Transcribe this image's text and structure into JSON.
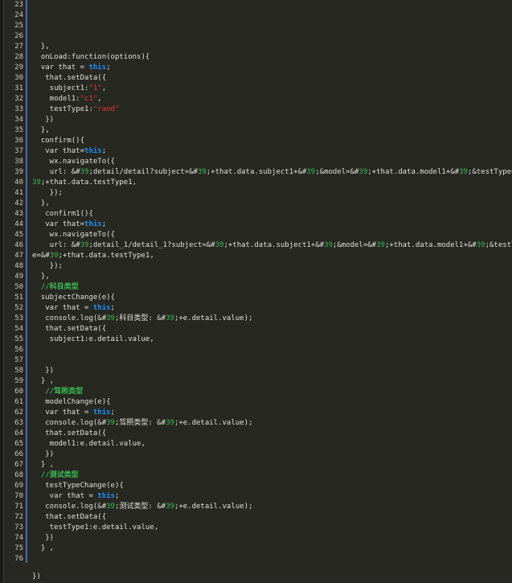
{
  "editor": {
    "closing": "})",
    "lines": [
      {
        "n": "23",
        "segs": []
      },
      {
        "n": "24",
        "segs": []
      },
      {
        "n": "25",
        "segs": []
      },
      {
        "n": "26",
        "segs": []
      },
      {
        "n": "27",
        "segs": [
          {
            "t": "  },",
            "c": ""
          }
        ]
      },
      {
        "n": "28",
        "segs": [
          {
            "t": "  onLoad:function(options){",
            "c": ""
          }
        ]
      },
      {
        "n": "29",
        "segs": [
          {
            "t": "  var that = ",
            "c": ""
          },
          {
            "t": "this",
            "c": "kw"
          },
          {
            "t": ";",
            "c": ""
          }
        ]
      },
      {
        "n": "30",
        "segs": [
          {
            "t": "   that.setData({",
            "c": ""
          }
        ]
      },
      {
        "n": "31",
        "segs": [
          {
            "t": "    subject1:",
            "c": ""
          },
          {
            "t": "\"1\"",
            "c": "str"
          },
          {
            "t": ",",
            "c": ""
          }
        ]
      },
      {
        "n": "32",
        "segs": [
          {
            "t": "    model1:",
            "c": ""
          },
          {
            "t": "\"c1\"",
            "c": "str"
          },
          {
            "t": ",",
            "c": ""
          }
        ]
      },
      {
        "n": "33",
        "segs": [
          {
            "t": "    testType1:",
            "c": ""
          },
          {
            "t": "\"rand\"",
            "c": "str"
          }
        ]
      },
      {
        "n": "34",
        "segs": [
          {
            "t": "   })",
            "c": ""
          }
        ]
      },
      {
        "n": "35",
        "segs": [
          {
            "t": "  },",
            "c": ""
          }
        ]
      },
      {
        "n": "36",
        "segs": [
          {
            "t": "  confirm(){",
            "c": ""
          }
        ]
      },
      {
        "n": "37",
        "segs": [
          {
            "t": "   var that=",
            "c": ""
          },
          {
            "t": "this",
            "c": "kw"
          },
          {
            "t": ";",
            "c": ""
          }
        ]
      },
      {
        "n": "38",
        "segs": [
          {
            "t": "    wx.navigateTo({",
            "c": ""
          }
        ]
      },
      {
        "n": "39",
        "segs": [
          {
            "t": "    url: &#",
            "c": ""
          },
          {
            "t": "39",
            "c": "ent"
          },
          {
            "t": ";detail/detail?subject=&#",
            "c": ""
          },
          {
            "t": "39",
            "c": "ent"
          },
          {
            "t": ";+that.data.subject1+&#",
            "c": ""
          },
          {
            "t": "39",
            "c": "ent"
          },
          {
            "t": ";&model=&#",
            "c": ""
          },
          {
            "t": "39",
            "c": "ent"
          },
          {
            "t": ";+that.data.model1+&#",
            "c": ""
          },
          {
            "t": "39",
            "c": "ent"
          },
          {
            "t": ";&testType=&#",
            "c": ""
          }
        ]
      },
      {
        "n": "40",
        "segs": [
          {
            "t": "39",
            "c": "ent"
          },
          {
            "t": ";+that.data.testType1,",
            "c": ""
          }
        ]
      },
      {
        "n": "41",
        "segs": [
          {
            "t": "    });",
            "c": ""
          }
        ]
      },
      {
        "n": "42",
        "segs": [
          {
            "t": "  },",
            "c": ""
          }
        ]
      },
      {
        "n": "43",
        "segs": [
          {
            "t": "   confirm1(){",
            "c": ""
          }
        ]
      },
      {
        "n": "44",
        "segs": [
          {
            "t": "   var that=",
            "c": ""
          },
          {
            "t": "this",
            "c": "kw"
          },
          {
            "t": ";",
            "c": ""
          }
        ]
      },
      {
        "n": "45",
        "segs": [
          {
            "t": "    wx.navigateTo({",
            "c": ""
          }
        ]
      },
      {
        "n": "46",
        "segs": [
          {
            "t": "    url: &#",
            "c": ""
          },
          {
            "t": "39",
            "c": "ent"
          },
          {
            "t": ";detail_1/detail_1?subject=&#",
            "c": ""
          },
          {
            "t": "39",
            "c": "ent"
          },
          {
            "t": ";+that.data.subject1+&#",
            "c": ""
          },
          {
            "t": "39",
            "c": "ent"
          },
          {
            "t": ";&model=&#",
            "c": ""
          },
          {
            "t": "39",
            "c": "ent"
          },
          {
            "t": ";+that.data.model1+&#",
            "c": ""
          },
          {
            "t": "39",
            "c": "ent"
          },
          {
            "t": ";&testTyp",
            "c": ""
          }
        ]
      },
      {
        "n": "47",
        "segs": [
          {
            "t": "e=&#",
            "c": ""
          },
          {
            "t": "39",
            "c": "ent"
          },
          {
            "t": ";+that.data.testType1,",
            "c": ""
          }
        ]
      },
      {
        "n": "48",
        "segs": [
          {
            "t": "    });",
            "c": ""
          }
        ]
      },
      {
        "n": "49",
        "segs": [
          {
            "t": "  },",
            "c": ""
          }
        ]
      },
      {
        "n": "50",
        "segs": [
          {
            "t": "  //科目类型",
            "c": "cmt"
          }
        ]
      },
      {
        "n": "51",
        "segs": [
          {
            "t": "  subjectChange(e){",
            "c": ""
          }
        ]
      },
      {
        "n": "52",
        "segs": [
          {
            "t": "   var that = ",
            "c": ""
          },
          {
            "t": "this",
            "c": "kw"
          },
          {
            "t": ";",
            "c": ""
          }
        ]
      },
      {
        "n": "53",
        "segs": [
          {
            "t": "   console.log(&#",
            "c": ""
          },
          {
            "t": "39",
            "c": "ent"
          },
          {
            "t": ";科目类型: &#",
            "c": ""
          },
          {
            "t": "39",
            "c": "ent"
          },
          {
            "t": ";+e.detail.value);",
            "c": ""
          }
        ]
      },
      {
        "n": "54",
        "segs": [
          {
            "t": "   that.setData({",
            "c": ""
          }
        ]
      },
      {
        "n": "55",
        "segs": [
          {
            "t": "    subject1:e.detail.value,",
            "c": ""
          }
        ]
      },
      {
        "n": "56",
        "segs": []
      },
      {
        "n": "57",
        "segs": []
      },
      {
        "n": "58",
        "segs": [
          {
            "t": "   })",
            "c": ""
          }
        ]
      },
      {
        "n": "59",
        "segs": [
          {
            "t": "  } ,",
            "c": ""
          }
        ]
      },
      {
        "n": "60",
        "segs": [
          {
            "t": "   //驾照类型",
            "c": "cmt"
          }
        ]
      },
      {
        "n": "61",
        "segs": [
          {
            "t": "   modelChange(e){",
            "c": ""
          }
        ]
      },
      {
        "n": "62",
        "segs": [
          {
            "t": "   var that = ",
            "c": ""
          },
          {
            "t": "this",
            "c": "kw"
          },
          {
            "t": ";",
            "c": ""
          }
        ]
      },
      {
        "n": "63",
        "segs": [
          {
            "t": "   console.log(&#",
            "c": ""
          },
          {
            "t": "39",
            "c": "ent"
          },
          {
            "t": ";驾照类型: &#",
            "c": ""
          },
          {
            "t": "39",
            "c": "ent"
          },
          {
            "t": ";+e.detail.value);",
            "c": ""
          }
        ]
      },
      {
        "n": "64",
        "segs": [
          {
            "t": "   that.setData({",
            "c": ""
          }
        ]
      },
      {
        "n": "65",
        "segs": [
          {
            "t": "    model1:e.detail.value,",
            "c": ""
          }
        ]
      },
      {
        "n": "66",
        "segs": [
          {
            "t": "   })",
            "c": ""
          }
        ]
      },
      {
        "n": "67",
        "segs": [
          {
            "t": "  } ,",
            "c": ""
          }
        ]
      },
      {
        "n": "68",
        "segs": [
          {
            "t": "  //测试类型",
            "c": "cmt"
          }
        ]
      },
      {
        "n": "69",
        "segs": [
          {
            "t": "   testTypeChange(e){",
            "c": ""
          }
        ]
      },
      {
        "n": "70",
        "segs": [
          {
            "t": "    var that = ",
            "c": ""
          },
          {
            "t": "this",
            "c": "kw"
          },
          {
            "t": ";",
            "c": ""
          }
        ]
      },
      {
        "n": "71",
        "segs": [
          {
            "t": "   console.log(&#",
            "c": ""
          },
          {
            "t": "39",
            "c": "ent"
          },
          {
            "t": ";测试类型: &#",
            "c": ""
          },
          {
            "t": "39",
            "c": "ent"
          },
          {
            "t": ";+e.detail.value);",
            "c": ""
          }
        ]
      },
      {
        "n": "72",
        "segs": [
          {
            "t": "   that.setData({",
            "c": ""
          }
        ]
      },
      {
        "n": "73",
        "segs": [
          {
            "t": "    testType1:e.detail.value,",
            "c": ""
          }
        ]
      },
      {
        "n": "74",
        "segs": [
          {
            "t": "   })",
            "c": ""
          }
        ]
      },
      {
        "n": "75",
        "segs": [
          {
            "t": "  } ,",
            "c": ""
          }
        ]
      },
      {
        "n": "76",
        "segs": []
      }
    ]
  }
}
